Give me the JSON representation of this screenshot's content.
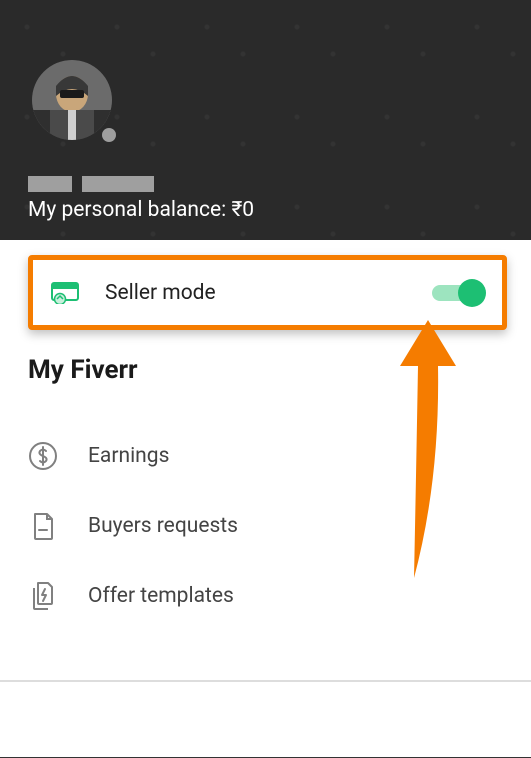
{
  "header": {
    "balance_label": "My personal balance: ",
    "balance_value": "₹0"
  },
  "seller_mode": {
    "label": "Seller mode",
    "enabled": true
  },
  "section": {
    "title": "My Fiverr"
  },
  "menu": [
    {
      "label": "Earnings"
    },
    {
      "label": "Buyers requests"
    },
    {
      "label": "Offer templates"
    }
  ],
  "colors": {
    "accent": "#1dbf73",
    "highlight": "#f57c00"
  }
}
